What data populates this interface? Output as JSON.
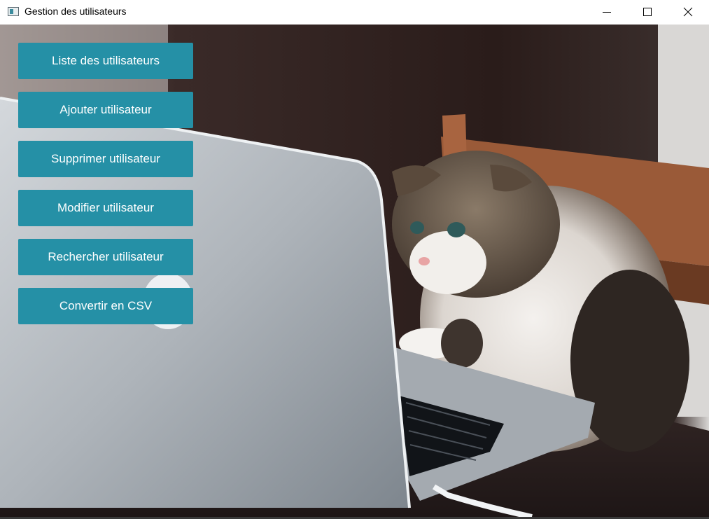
{
  "window": {
    "title": "Gestion des utilisateurs",
    "controls": {
      "minimize_icon": "minimize-icon",
      "maximize_icon": "maximize-icon",
      "close_icon": "close-icon"
    }
  },
  "background": {
    "image": "cat-using-laptop-photo"
  },
  "menu": {
    "accent": "#2590a6",
    "items": [
      {
        "label": "Liste des utilisateurs"
      },
      {
        "label": "Ajouter utilisateur"
      },
      {
        "label": "Supprimer utilisateur"
      },
      {
        "label": "Modifier utilisateur"
      },
      {
        "label": "Rechercher utilisateur"
      },
      {
        "label": "Convertir en CSV"
      }
    ]
  }
}
